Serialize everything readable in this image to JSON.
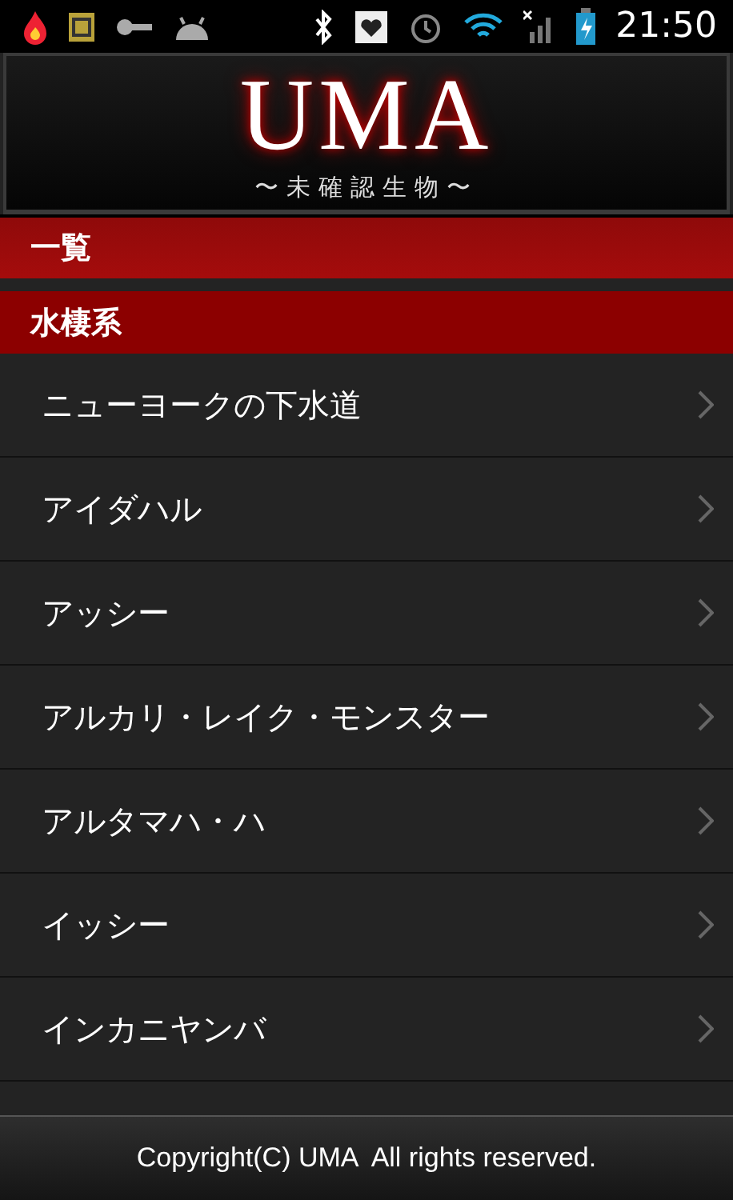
{
  "status_bar": {
    "time": "21:50"
  },
  "header": {
    "title": "UMA",
    "subtitle": "〜未確認生物〜"
  },
  "sections": [
    {
      "title": "一覧",
      "kind": "top"
    },
    {
      "title": "水棲系",
      "kind": "category"
    }
  ],
  "items": [
    {
      "label": "ニューヨークの下水道"
    },
    {
      "label": "アイダハル"
    },
    {
      "label": "アッシー"
    },
    {
      "label": "アルカリ・レイク・モンスター"
    },
    {
      "label": "アルタマハ・ハ"
    },
    {
      "label": "イッシー"
    },
    {
      "label": "インカニヤンバ"
    }
  ],
  "footer": {
    "text": "Copyright(C) UMA  All rights reserved."
  }
}
